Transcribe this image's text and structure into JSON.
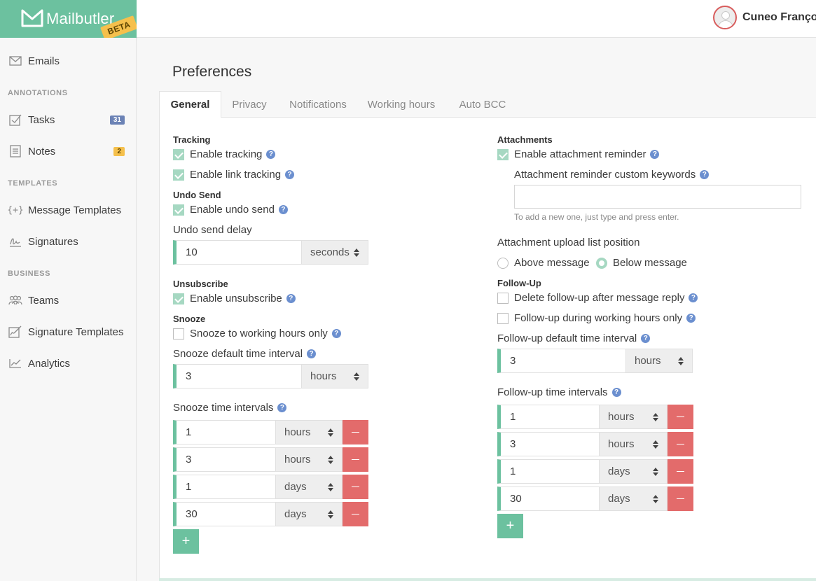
{
  "brand": {
    "name": "Mailbutler",
    "badge": "BETA"
  },
  "user": {
    "name": "Cuneo François"
  },
  "sidebar": {
    "emails": "Emails",
    "sections": {
      "annotations": "ANNOTATIONS",
      "templates": "TEMPLATES",
      "business": "BUSINESS"
    },
    "tasks": {
      "label": "Tasks",
      "count": "31"
    },
    "notes": {
      "label": "Notes",
      "count": "2"
    },
    "message_templates": "Message Templates",
    "signatures": "Signatures",
    "teams": "Teams",
    "signature_templates": "Signature Templates",
    "analytics": "Analytics"
  },
  "page": {
    "title": "Preferences"
  },
  "tabs": [
    "General",
    "Privacy",
    "Notifications",
    "Working hours",
    "Auto BCC"
  ],
  "general": {
    "tracking": {
      "heading": "Tracking",
      "enable_tracking": "Enable tracking",
      "enable_link_tracking": "Enable link tracking"
    },
    "undo_send": {
      "heading": "Undo Send",
      "enable_undo_send": "Enable undo send",
      "delay_label": "Undo send delay",
      "delay_value": "10",
      "delay_unit": "seconds"
    },
    "unsubscribe": {
      "heading": "Unsubscribe",
      "enable_unsubscribe": "Enable unsubscribe"
    },
    "snooze": {
      "heading": "Snooze",
      "working_hours_only": "Snooze to working hours only",
      "default_interval_label": "Snooze default time interval",
      "default_value": "3",
      "default_unit": "hours",
      "intervals_label": "Snooze time intervals",
      "intervals": [
        {
          "value": "1",
          "unit": "hours"
        },
        {
          "value": "3",
          "unit": "hours"
        },
        {
          "value": "1",
          "unit": "days"
        },
        {
          "value": "30",
          "unit": "days"
        }
      ],
      "add_symbol": "+"
    },
    "attachments": {
      "heading": "Attachments",
      "enable_reminder": "Enable attachment reminder",
      "keywords_label": "Attachment reminder custom keywords",
      "keywords_value": "",
      "keywords_hint": "To add a new one, just type and press enter.",
      "position_label": "Attachment upload list position",
      "above": "Above message",
      "below": "Below message"
    },
    "follow_up": {
      "heading": "Follow-Up",
      "delete_after_reply": "Delete follow-up after message reply",
      "working_hours_only": "Follow-up during working hours only",
      "default_interval_label": "Follow-up default time interval",
      "default_value": "3",
      "default_unit": "hours",
      "intervals_label": "Follow-up time intervals",
      "intervals": [
        {
          "value": "1",
          "unit": "hours"
        },
        {
          "value": "3",
          "unit": "hours"
        },
        {
          "value": "1",
          "unit": "days"
        },
        {
          "value": "30",
          "unit": "days"
        }
      ],
      "add_symbol": "+"
    }
  },
  "colors": {
    "brand_green": "#6cc19f",
    "remove_red": "#e36b6b",
    "badge_yellow": "#f5c04c",
    "badge_blue": "#6b82b5"
  }
}
